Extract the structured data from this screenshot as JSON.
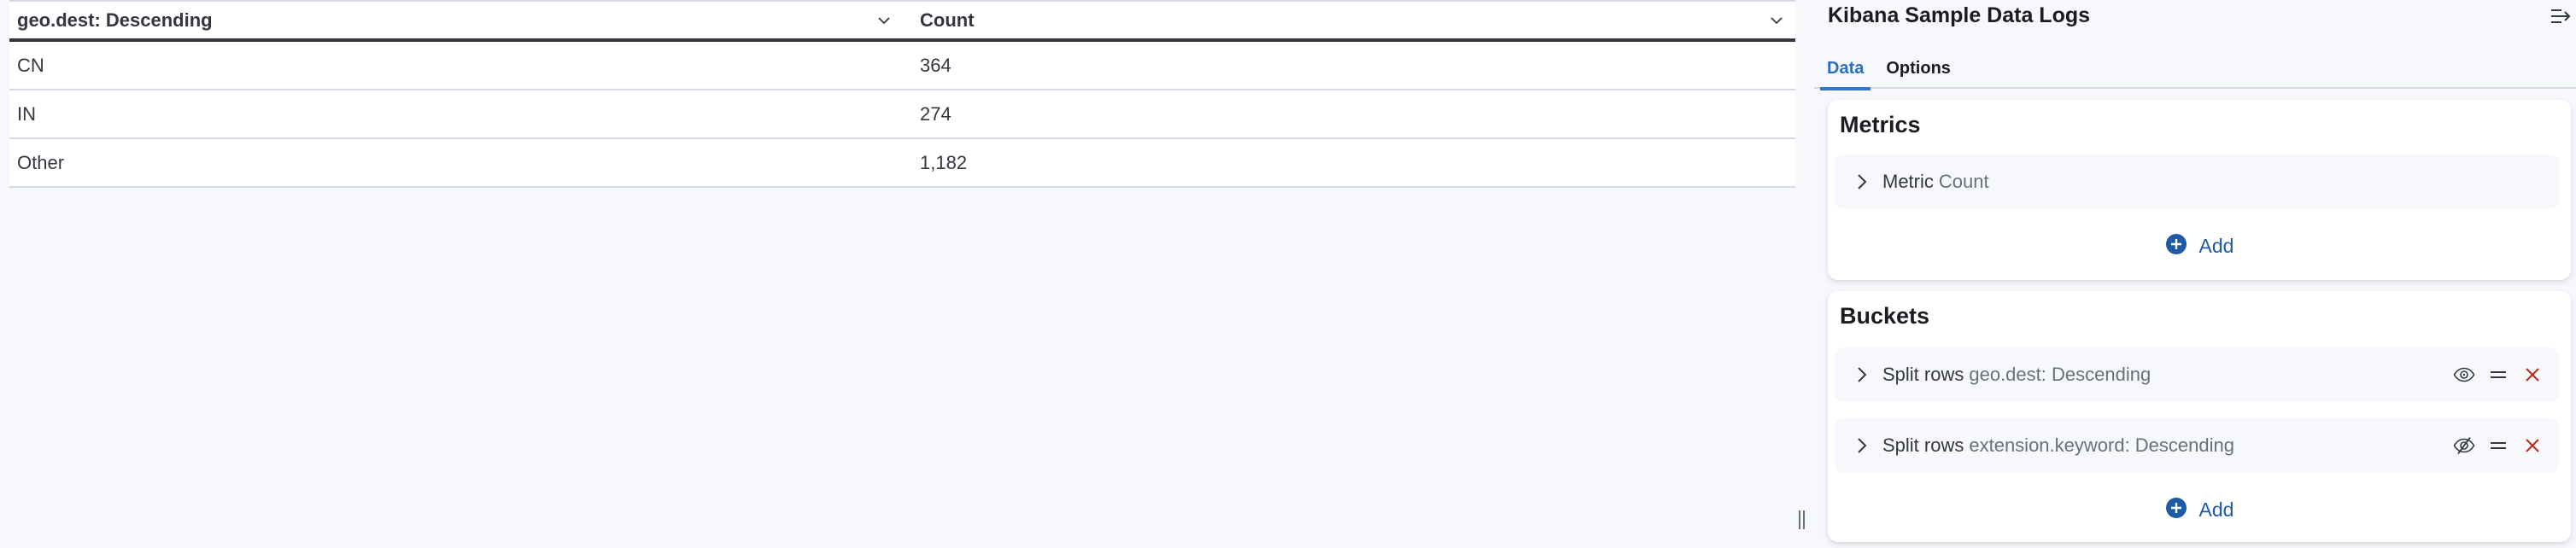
{
  "table": {
    "columns": [
      {
        "label": "geo.dest: Descending"
      },
      {
        "label": "Count"
      }
    ],
    "rows": [
      {
        "geo_dest": "CN",
        "count": "364"
      },
      {
        "geo_dest": "IN",
        "count": "274"
      },
      {
        "geo_dest": "Other",
        "count": "1,182"
      }
    ]
  },
  "sidebar": {
    "title": "Kibana Sample Data Logs",
    "tabs": [
      {
        "label": "Data",
        "active": true
      },
      {
        "label": "Options",
        "active": false
      }
    ],
    "metrics": {
      "title": "Metrics",
      "items": [
        {
          "type": "Metric",
          "description": "Count"
        }
      ],
      "add_label": "Add"
    },
    "buckets": {
      "title": "Buckets",
      "items": [
        {
          "type": "Split rows",
          "description": "geo.dest: Descending",
          "enabled": true
        },
        {
          "type": "Split rows",
          "description": "extension.keyword: Descending",
          "enabled": false
        }
      ],
      "add_label": "Add"
    }
  },
  "colors": {
    "accent": "#2f75c8",
    "add_button": "#1f5aa6",
    "danger": "#bd271e",
    "text": "#343741",
    "subdued_text": "#69707d",
    "background": "#f7f8fc"
  }
}
